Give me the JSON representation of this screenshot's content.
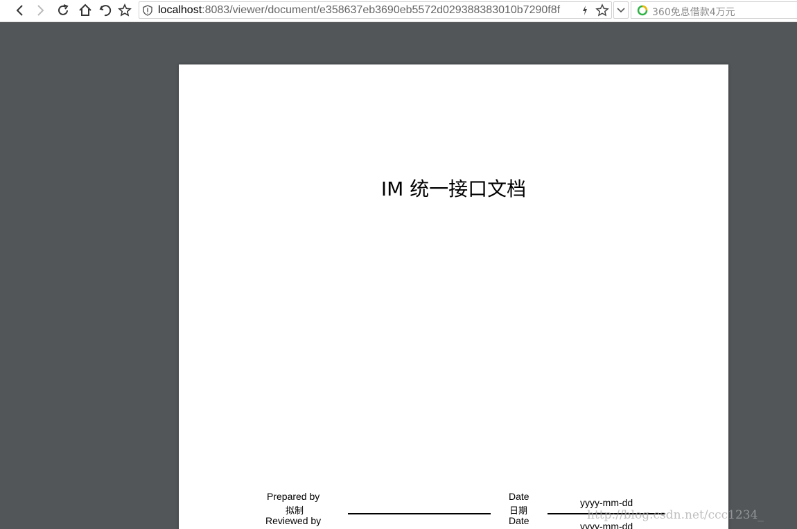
{
  "browser": {
    "address_host": "localhost",
    "address_rest": ":8083/viewer/document/e358637eb3690eb5572d029388383010b7290f8f",
    "search_placeholder": "360免息借款4万元",
    "icons": [
      "back-icon",
      "forward-icon",
      "reload-icon",
      "home-icon",
      "undo-icon",
      "bookmark-star-icon",
      "shield-icon",
      "bolt-icon",
      "favorite-star-icon",
      "chevron-down-icon",
      "search-logo-icon"
    ]
  },
  "document": {
    "title": "IM 统一接口文档",
    "prepared_by_label": "Prepared by",
    "prepared_by_cn": "拟制",
    "reviewed_by_label": "Reviewed by",
    "date_label": "Date",
    "date_cn": "日期",
    "date_label_2": "Date",
    "date_value": "yyyy-mm-dd",
    "date_value_2": "yyyy-mm-dd"
  },
  "watermark": "http://blog.csdn.net/ccc1234_",
  "colors": {
    "viewer_bg": "#525659",
    "page_bg": "#ffffff",
    "toolbar_bg": "#ffffff"
  }
}
